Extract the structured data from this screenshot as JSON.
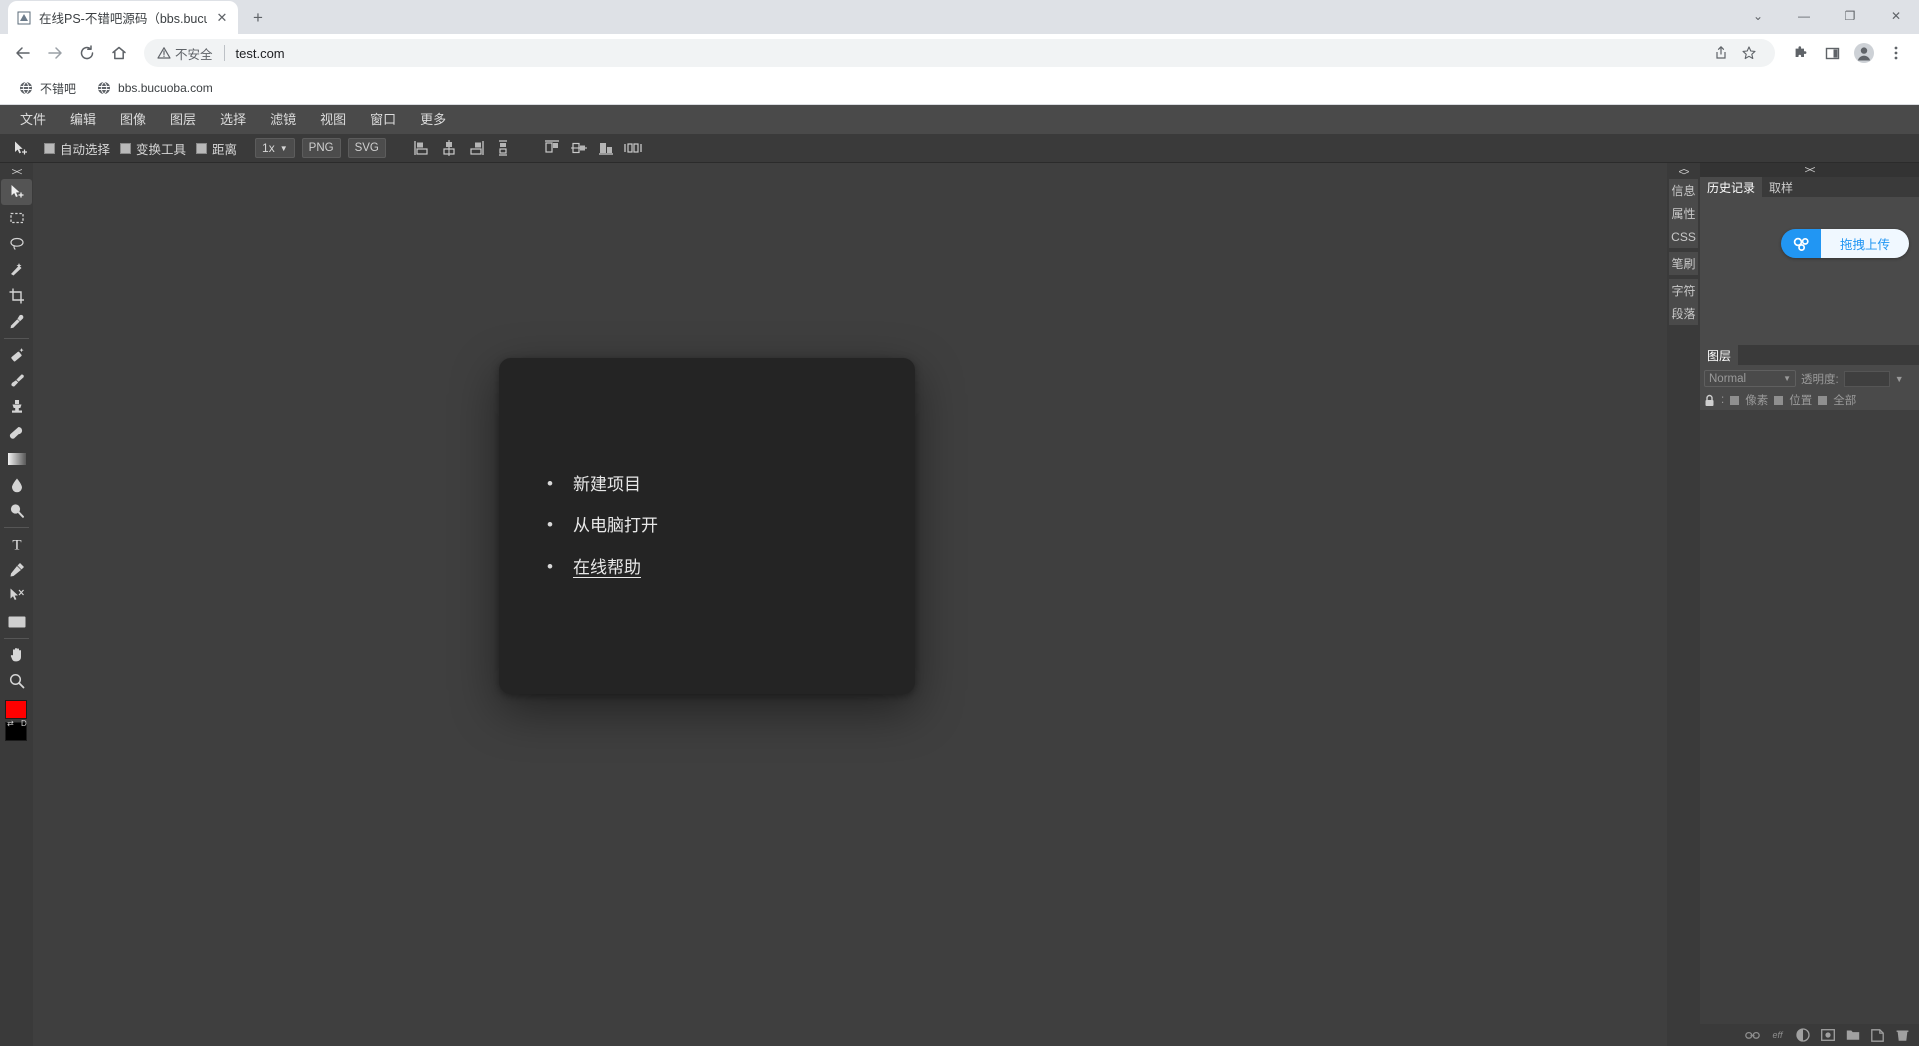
{
  "browser": {
    "tab": {
      "title": "在线PS-不错吧源码（bbs.bucuo",
      "favicon": "ps-icon",
      "close_label": "✕"
    },
    "new_tab_label": "+",
    "window_controls": {
      "tab_search": "⌄",
      "minimize": "—",
      "maximize": "❐",
      "close": "✕"
    },
    "nav": {
      "back": "←",
      "forward": "→",
      "reload": "⟳",
      "home": "⌂"
    },
    "omnibox": {
      "security_label": "不安全",
      "security_icon": "warning-triangle-icon",
      "url": "test.com",
      "share_icon": "share-icon",
      "bookmark_icon": "star-icon"
    },
    "toolbar_icons": {
      "extensions": "puzzle-icon",
      "side_panel": "side-panel-icon",
      "profile": "avatar-icon",
      "menu": "three-dot-menu-icon"
    },
    "bookmarks": [
      {
        "label": "不错吧",
        "icon": "globe-icon"
      },
      {
        "label": "bbs.bucuoba.com",
        "icon": "globe-icon"
      }
    ]
  },
  "app": {
    "menubar": [
      "文件",
      "编辑",
      "图像",
      "图层",
      "选择",
      "滤镜",
      "视图",
      "窗口",
      "更多"
    ],
    "optionbar": {
      "active_tool_icon": "move-tool-icon",
      "checkboxes": [
        {
          "label": "自动选择",
          "checked": false
        },
        {
          "label": "变换工具",
          "checked": false
        },
        {
          "label": "距离",
          "checked": false
        }
      ],
      "scale_select": {
        "value": "1x",
        "caret": "▼"
      },
      "export_buttons": [
        "PNG",
        "SVG"
      ],
      "align_icons": [
        "align-left-icon",
        "align-center-h-icon",
        "align-right-icon",
        "distribute-v-icon",
        "align-top-icon",
        "align-middle-v-icon",
        "align-bottom-icon",
        "distribute-h-icon"
      ]
    },
    "toolbar": {
      "collapse_label": "><",
      "tools": [
        {
          "name": "move-tool",
          "active": true
        },
        {
          "name": "marquee-tool",
          "active": false
        },
        {
          "name": "lasso-tool",
          "active": false
        },
        {
          "name": "magic-wand-tool",
          "active": false
        },
        {
          "name": "crop-tool",
          "active": false
        },
        {
          "name": "eyedropper-tool",
          "active": false
        },
        {
          "name": "healing-brush-tool",
          "active": false
        },
        {
          "name": "brush-tool",
          "active": false
        },
        {
          "name": "clone-stamp-tool",
          "active": false
        },
        {
          "name": "eraser-tool",
          "active": false
        },
        {
          "name": "gradient-tool",
          "active": false
        },
        {
          "name": "blur-tool",
          "active": false
        },
        {
          "name": "dodge-tool",
          "active": false
        },
        {
          "name": "text-tool",
          "active": false
        },
        {
          "name": "pen-tool",
          "active": false
        },
        {
          "name": "path-select-tool",
          "active": false
        },
        {
          "name": "shape-tool",
          "active": false
        },
        {
          "name": "hand-tool",
          "active": false
        },
        {
          "name": "zoom-tool",
          "active": false
        }
      ],
      "swatches": {
        "foreground": "#ff0000",
        "background": "#000000",
        "swap_label": "⇄",
        "default_label": "D"
      }
    },
    "canvas": {
      "start_modal": {
        "items": [
          {
            "label": "新建项目",
            "link": false
          },
          {
            "label": "从电脑打开",
            "link": false
          },
          {
            "label": "在线帮助",
            "link": true
          }
        ]
      }
    },
    "right_sidebar": {
      "collapse_label": "<>",
      "vertical_tabs": [
        "信息",
        "属性",
        "CSS",
        "笔刷",
        "字符",
        "段落"
      ],
      "panel": {
        "collapse_label": "><",
        "tabs": [
          {
            "label": "历史记录",
            "active": true
          },
          {
            "label": "取样",
            "active": false
          }
        ],
        "upload_button": {
          "label": "拖拽上传",
          "icon": "cloud-upload-icon",
          "accent": "#2196f3"
        }
      },
      "layers": {
        "tab_label": "图层",
        "blend_mode": "Normal",
        "blend_caret": "▼",
        "opacity_label": "透明度:",
        "opacity_value": "",
        "opacity_caret": "▼",
        "lock_icon": "lock-icon",
        "lock_colon": ":",
        "lock_options": [
          {
            "label": "像素"
          },
          {
            "label": "位置"
          },
          {
            "label": "全部"
          }
        ],
        "bottom_icons": [
          {
            "name": "link-layers-icon",
            "glyph": "⛓"
          },
          {
            "name": "layer-effects-icon",
            "glyph": "eff"
          },
          {
            "name": "adjustment-layer-icon",
            "glyph": "◑"
          },
          {
            "name": "layer-mask-icon",
            "glyph": "▣"
          },
          {
            "name": "new-group-icon",
            "glyph": "🗀"
          },
          {
            "name": "new-layer-icon",
            "glyph": "🗋"
          },
          {
            "name": "delete-layer-icon",
            "glyph": "🗑"
          }
        ]
      }
    }
  }
}
